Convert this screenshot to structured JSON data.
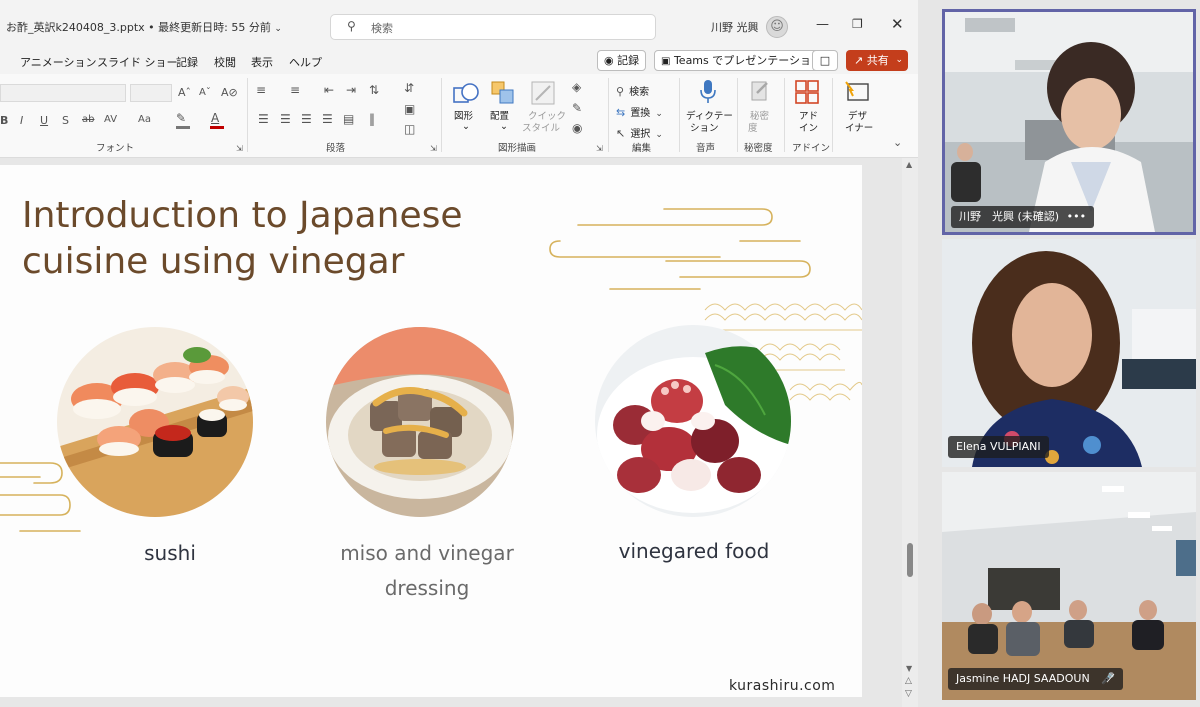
{
  "window": {
    "doc_title": "お酢_英訳k240408_3.pptx • 最終更新日時: 55 分前",
    "search_placeholder": "検索",
    "user_name": "川野 光興"
  },
  "menu": {
    "items": [
      "アニメーション",
      "スライド ショー",
      "記録",
      "校閲",
      "表示",
      "ヘルプ"
    ],
    "record_label": "記録",
    "teams_label": "Teams でプレゼンテーション",
    "share_label": "共有"
  },
  "ribbon": {
    "groups": [
      "フォント",
      "段落",
      "図形描画",
      "編集",
      "音声",
      "秘密度",
      "アドイン"
    ],
    "buttons": {
      "shape": "図形",
      "arrange": "配置",
      "quick_style_1": "クイック",
      "quick_style_2": "スタイル",
      "find": "検索",
      "replace": "置換",
      "select": "選択",
      "dictate_1": "ディクテー",
      "dictate_2": "ション",
      "sensitivity_1": "秘密",
      "sensitivity_2": "度",
      "addin_1": "アド",
      "addin_2": "イン",
      "designer_1": "デザ",
      "designer_2": "イナー"
    },
    "font_glyphs": {
      "bold": "B",
      "italic": "I",
      "underline": "U",
      "shadow": "S",
      "strike": "ab",
      "spacing": "AV",
      "case": "Aa"
    }
  },
  "slide": {
    "title_line1": "Introduction to Japanese",
    "title_line2": "cuisine using vinegar",
    "captions": [
      "sushi",
      "miso and vinegar",
      "dressing",
      "vinegared food"
    ],
    "credit": "kurashiru.com"
  },
  "participants": [
    {
      "name": "川野　光興 (未確認)",
      "active": true,
      "more": "•••"
    },
    {
      "name": "Elena VULPIANI",
      "active": false
    },
    {
      "name": "Jasmine HADJ SAADOUN",
      "active": false,
      "muted": true
    }
  ],
  "colors": {
    "title_brown": "#6b4a2b",
    "gold_wave": "#d6b25c",
    "share_orange": "#c43e1c",
    "active_speaker": "#6264a7"
  }
}
